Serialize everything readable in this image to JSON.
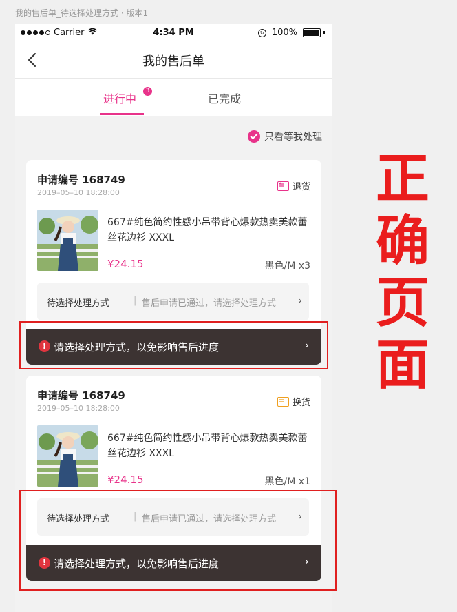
{
  "canvas_title": "我的售后单_待选择处理方式 · 版本1",
  "status_bar": {
    "carrier": "Carrier",
    "time": "4:34 PM",
    "battery": "100%"
  },
  "nav": {
    "title": "我的售后单"
  },
  "tabs": [
    {
      "label": "进行中",
      "badge": "3"
    },
    {
      "label": "已完成"
    }
  ],
  "filter": {
    "label": "只看等我处理"
  },
  "colors": {
    "accent": "#e8338a",
    "warn_bar": "#3c3332",
    "warn_icon": "#e0353f",
    "annotation": "#e02020",
    "return_tag": "#e8338a",
    "exchange_tag": "#f0a020"
  },
  "cards": [
    {
      "order_no": "申请编号 168749",
      "date": "2019–05–10 18:28:00",
      "type": "退货",
      "type_icon": "return-icon",
      "product_name": "667#纯色简约性感小吊带背心爆款热卖美款蕾丝花边衫 XXXL",
      "price": "¥24.15",
      "spec": "黑色/M x3",
      "method_label": "待选择处理方式",
      "method_sep": "|",
      "method_desc": "售后申请已通过，请选择处理方式",
      "warning": "请选择处理方式，以免影响售后进度"
    },
    {
      "order_no": "申请编号 168749",
      "date": "2019–05–10 18:28:00",
      "type": "换货",
      "type_icon": "exchange-icon",
      "product_name": "667#纯色简约性感小吊带背心爆款热卖美款蕾丝花边衫 XXXL",
      "price": "¥24.15",
      "spec": "黑色/M x1",
      "method_label": "待选择处理方式",
      "method_sep": "|",
      "method_desc": "售后申请已通过，请选择处理方式",
      "warning": "请选择处理方式，以免影响售后进度"
    }
  ],
  "annotation": [
    "正",
    "确",
    "页",
    "面"
  ]
}
